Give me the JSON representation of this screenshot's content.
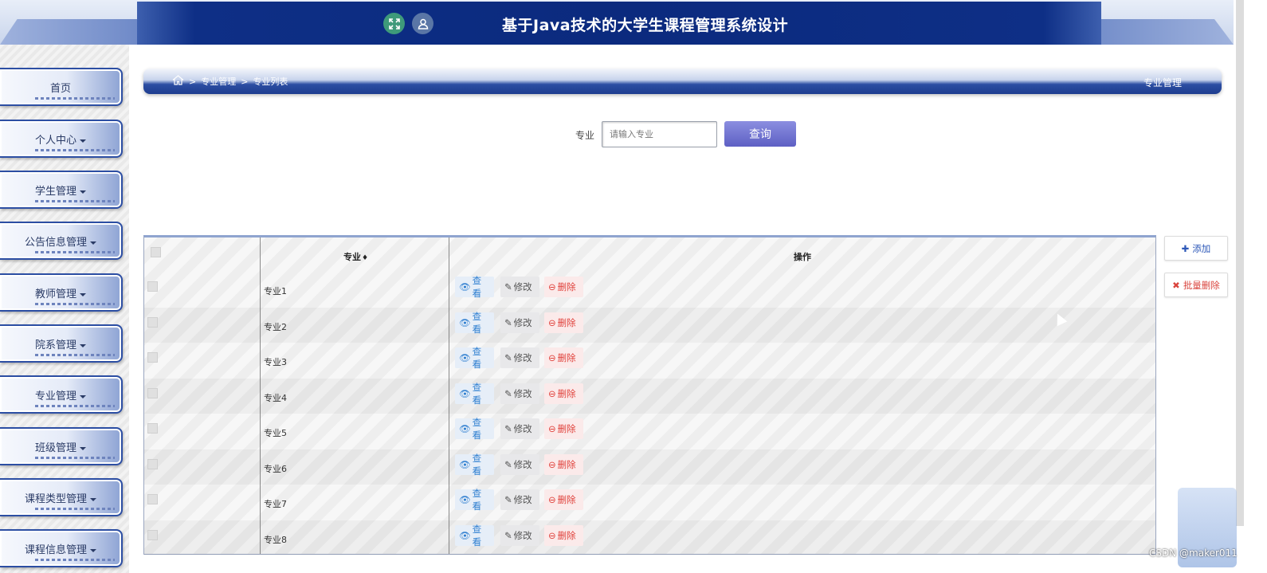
{
  "header": {
    "title": "基于Java技术的大学生课程管理系统设计",
    "icons": [
      "fullscreen-icon",
      "user-icon"
    ]
  },
  "sidebar": {
    "items": [
      {
        "label": "首页",
        "has_caret": false
      },
      {
        "label": "个人中心",
        "has_caret": true
      },
      {
        "label": "学生管理",
        "has_caret": true
      },
      {
        "label": "公告信息管理",
        "has_caret": true
      },
      {
        "label": "教师管理",
        "has_caret": true
      },
      {
        "label": "院系管理",
        "has_caret": true
      },
      {
        "label": "专业管理",
        "has_caret": true
      },
      {
        "label": "班级管理",
        "has_caret": true
      },
      {
        "label": "课程类型管理",
        "has_caret": true
      },
      {
        "label": "课程信息管理",
        "has_caret": true
      }
    ]
  },
  "breadcrumb": {
    "items": [
      "专业管理",
      "专业列表"
    ],
    "separator": ">",
    "section_title": "专业管理"
  },
  "search": {
    "label": "专业",
    "placeholder": "请输入专业",
    "button": "查询"
  },
  "table": {
    "columns": [
      "专业",
      "操作"
    ],
    "sort_symbol": "♦",
    "rows": [
      "专业1",
      "专业2",
      "专业3",
      "专业4",
      "专业5",
      "专业6",
      "专业7",
      "专业8"
    ],
    "actions": {
      "view": "查看",
      "edit": "修改",
      "delete": "删除"
    }
  },
  "side_actions": {
    "add": "添加",
    "bulk_delete": "批量删除"
  },
  "watermark": "CSDN @maker011",
  "colors": {
    "header_blue": "#0b2a7e",
    "nav_border": "#2c4ea3",
    "search_button": "#5e60c4",
    "view": "#2f7fd0",
    "delete": "#e0413b"
  }
}
